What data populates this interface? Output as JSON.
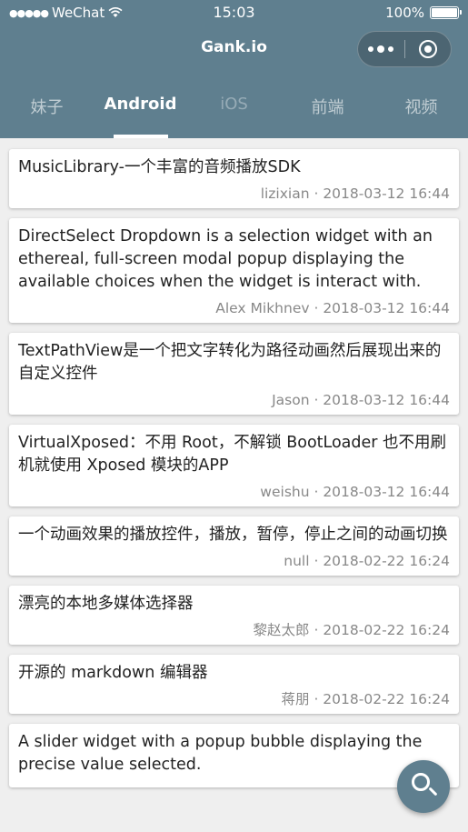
{
  "status": {
    "carrier": "WeChat",
    "time": "15:03",
    "battery": "100%",
    "battery_level": 1.0
  },
  "nav": {
    "title": "Gank.io"
  },
  "tabs": [
    {
      "label": "妹子"
    },
    {
      "label": "Android"
    },
    {
      "label": "iOS"
    },
    {
      "label": "前端"
    },
    {
      "label": "视频"
    }
  ],
  "articles": [
    {
      "title": "MusicLibrary-一个丰富的音频播放SDK",
      "meta": "lizixian · 2018-03-12 16:44"
    },
    {
      "title": "DirectSelect Dropdown is a selection widget with an ethereal, full-screen modal popup displaying the available choices when the widget is interact with.",
      "meta": "Alex Mikhnev · 2018-03-12 16:44"
    },
    {
      "title": "TextPathView是一个把文字转化为路径动画然后展现出来的自定义控件",
      "meta": "Jason · 2018-03-12 16:44"
    },
    {
      "title": "VirtualXposed：不用 Root，不解锁 BootLoader 也不用刷机就使用 Xposed 模块的APP",
      "meta": "weishu · 2018-03-12 16:44"
    },
    {
      "title": "一个动画效果的播放控件，播放，暂停，停止之间的动画切换",
      "meta": "null · 2018-02-22 16:24"
    },
    {
      "title": "漂亮的本地多媒体选择器",
      "meta": "黎赵太郎 · 2018-02-22 16:24"
    },
    {
      "title": "开源的 markdown 编辑器",
      "meta": "蒋朋 · 2018-02-22 16:24"
    },
    {
      "title": "A slider widget with a popup bubble displaying the precise value selected.",
      "meta": ""
    }
  ]
}
